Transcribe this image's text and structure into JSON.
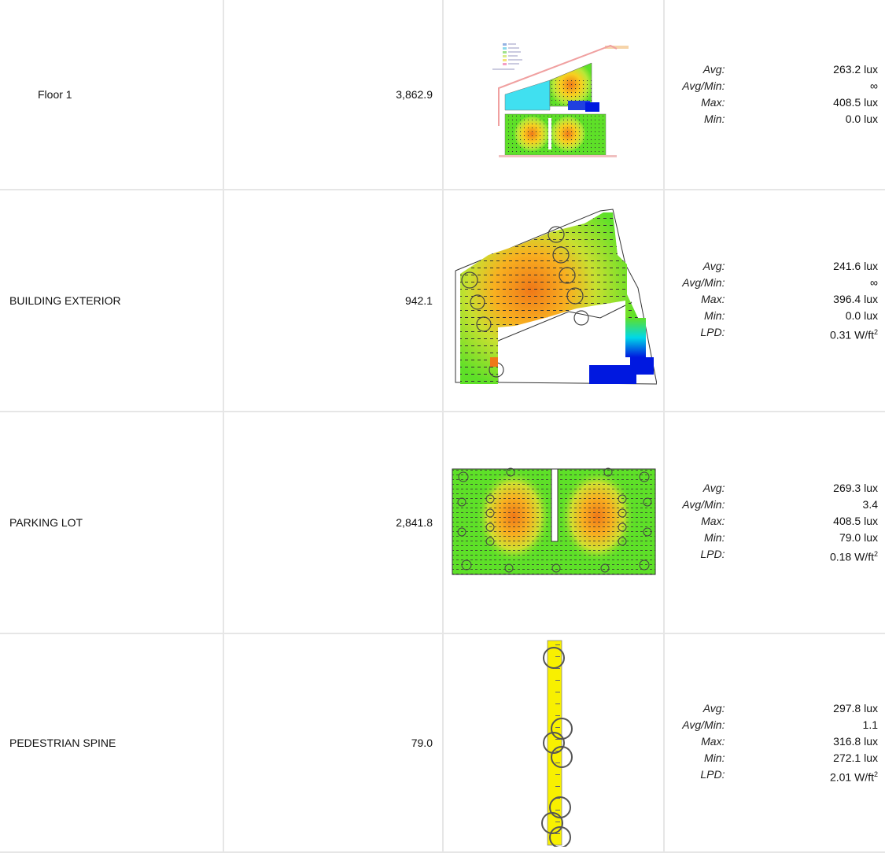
{
  "rows": [
    {
      "name": "Floor 1",
      "area": "3,862.9",
      "stats": [
        {
          "label": "Avg:",
          "value": "263.2 lux"
        },
        {
          "label": "Avg/Min:",
          "value": "∞"
        },
        {
          "label": "Max:",
          "value": "408.5 lux"
        },
        {
          "label": "Min:",
          "value": "0.0 lux"
        }
      ]
    },
    {
      "name": "BUILDING EXTERIOR",
      "area": "942.1",
      "stats": [
        {
          "label": "Avg:",
          "value": "241.6 lux"
        },
        {
          "label": "Avg/Min:",
          "value": "∞"
        },
        {
          "label": "Max:",
          "value": "396.4 lux"
        },
        {
          "label": "Min:",
          "value": "0.0 lux"
        },
        {
          "label": "LPD:",
          "value": "0.31 W/ft",
          "sup": "2"
        }
      ]
    },
    {
      "name": "PARKING LOT",
      "area": "2,841.8",
      "stats": [
        {
          "label": "Avg:",
          "value": "269.3 lux"
        },
        {
          "label": "Avg/Min:",
          "value": "3.4"
        },
        {
          "label": "Max:",
          "value": "408.5 lux"
        },
        {
          "label": "Min:",
          "value": "79.0 lux"
        },
        {
          "label": "LPD:",
          "value": "0.18 W/ft",
          "sup": "2"
        }
      ]
    },
    {
      "name": "PEDESTRIAN SPINE",
      "area": "79.0",
      "stats": [
        {
          "label": "Avg:",
          "value": "297.8 lux"
        },
        {
          "label": "Avg/Min:",
          "value": "1.1"
        },
        {
          "label": "Max:",
          "value": "316.8 lux"
        },
        {
          "label": "Min:",
          "value": "272.1 lux"
        },
        {
          "label": "LPD:",
          "value": "2.01 W/ft",
          "sup": "2"
        }
      ]
    }
  ],
  "heatmap_colors": {
    "hot": "#f07818",
    "warm": "#f8d020",
    "mid": "#b8e838",
    "cool": "#5ee028",
    "cold": "#00d8e8",
    "coldest": "#0018e0",
    "yellow": "#f8f000"
  },
  "icons": {
    "floor-1-thumb": "floor-plan-heatmap",
    "building-exterior-thumb": "exterior-heatmap",
    "parking-lot-thumb": "parking-heatmap",
    "pedestrian-spine-thumb": "spine-heatmap"
  }
}
